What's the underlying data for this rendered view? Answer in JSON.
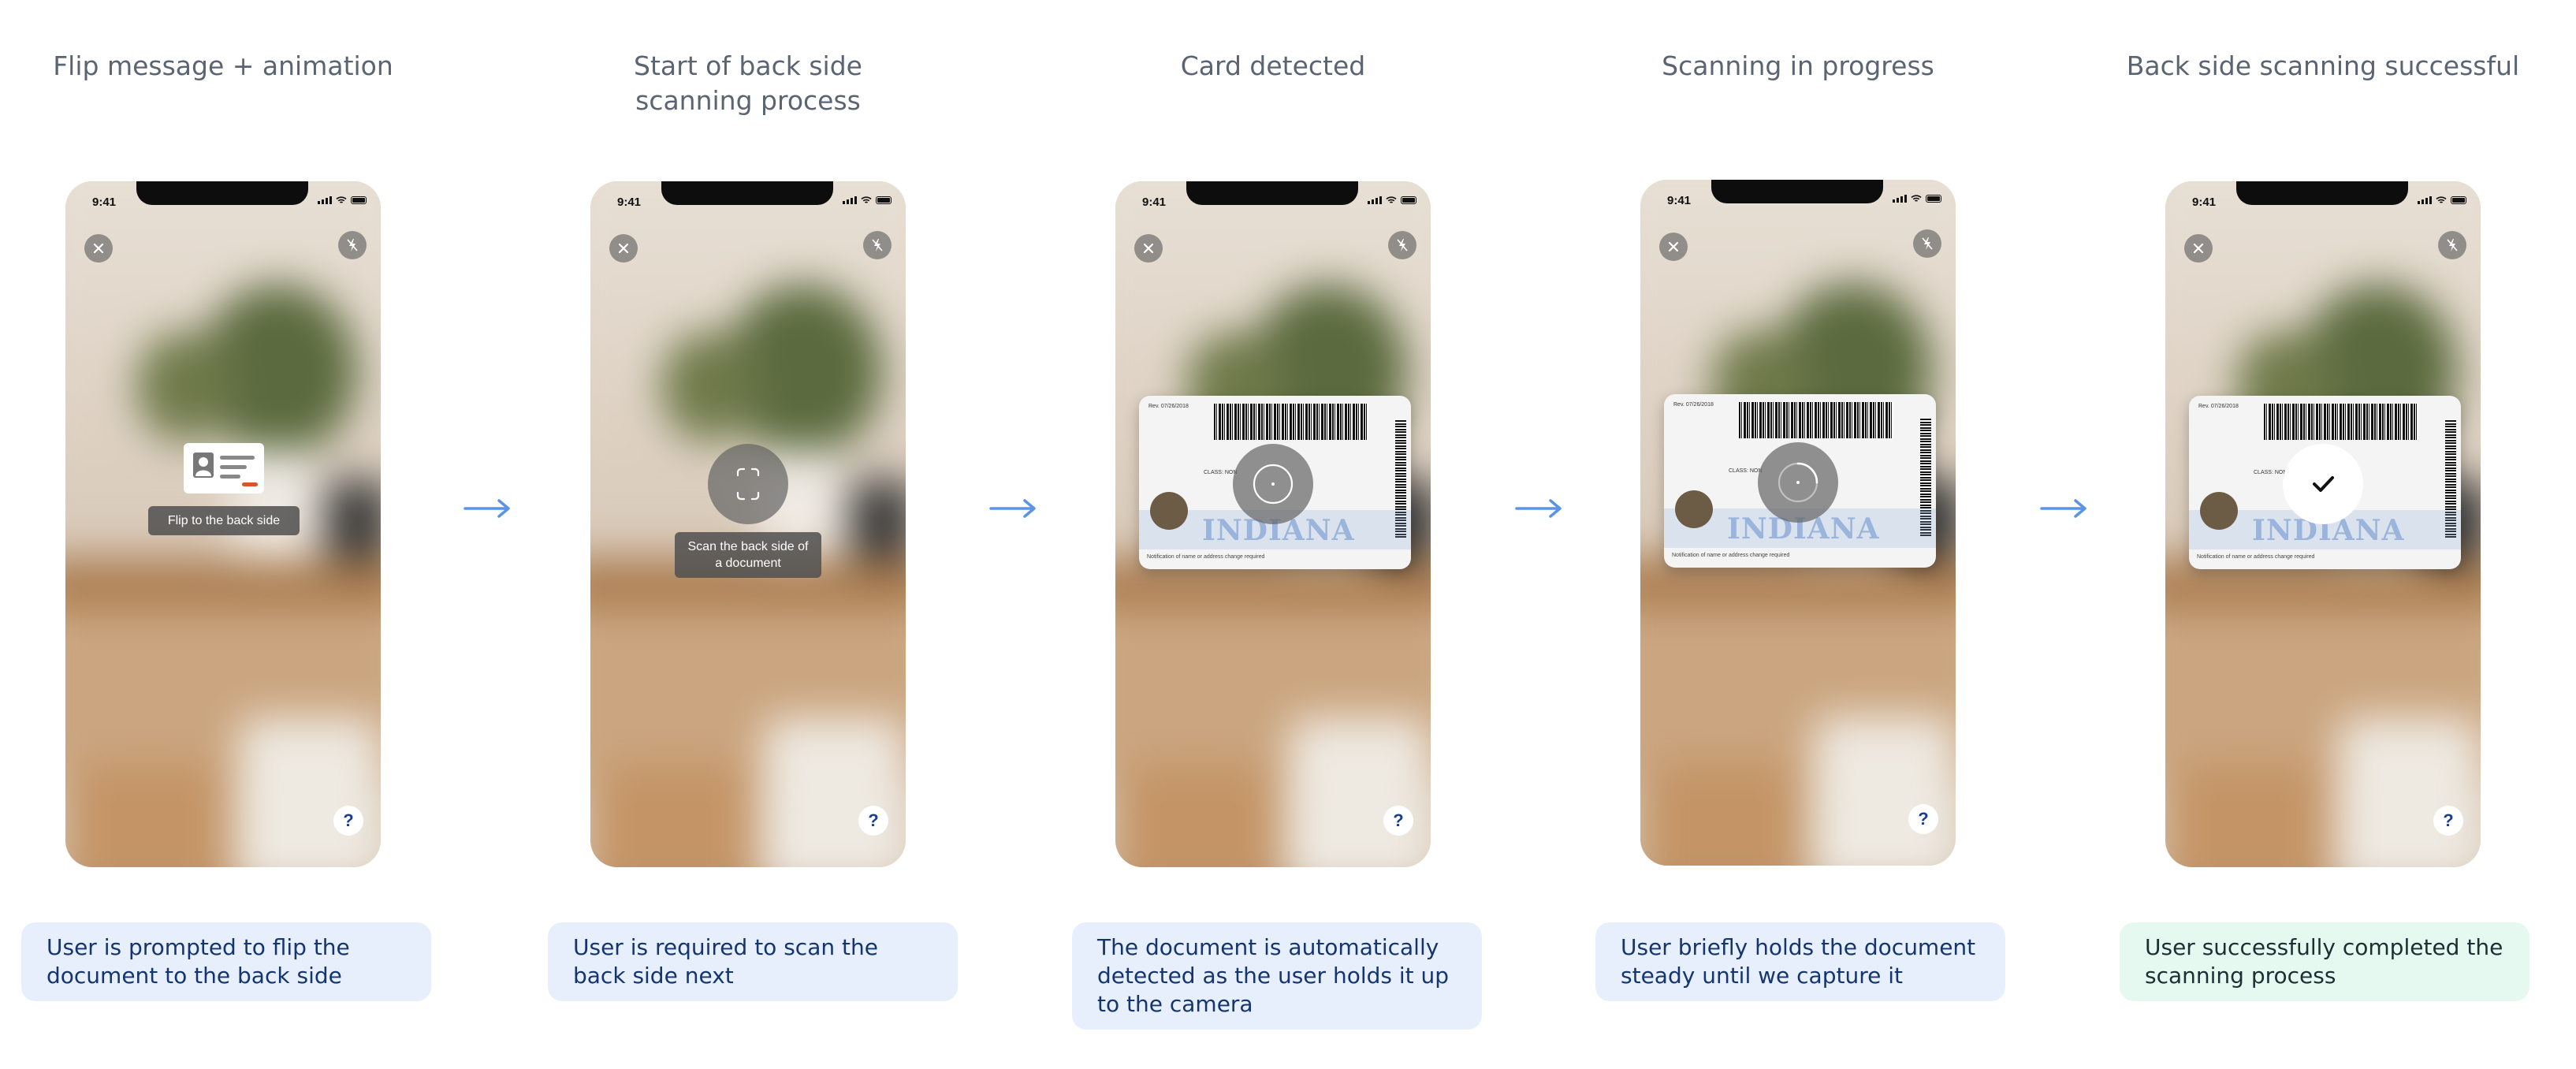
{
  "steps": [
    {
      "title": "Flip message + animation",
      "status_time": "9:41",
      "tooltip": "Flip to the back side",
      "help": "?",
      "caption": "User is prompted to flip the document to the back side"
    },
    {
      "title": "Start of back side scanning process",
      "status_time": "9:41",
      "tooltip": "Scan the back side of a document",
      "help": "?",
      "caption": "User is required to scan the back side next"
    },
    {
      "title": "Card detected",
      "status_time": "9:41",
      "help": "?",
      "card": {
        "state": "INDIANA",
        "exp": "Rev. 07/26/2018",
        "class": "CLASS: NON",
        "notice": "Notification of name or address change required"
      },
      "caption": "The document is automatically detected as the user holds it up to the camera"
    },
    {
      "title": "Scanning in progress",
      "status_time": "9:41",
      "help": "?",
      "card": {
        "state": "INDIANA",
        "exp": "Rev. 07/26/2018",
        "class": "CLASS: NON",
        "notice": "Notification of name or address change required"
      },
      "caption": "User briefly holds the document steady until we capture it"
    },
    {
      "title": "Back side scanning successful",
      "status_time": "9:41",
      "help": "?",
      "card": {
        "state": "INDIANA",
        "exp": "Rev. 07/26/2018",
        "class": "CLASS: NON",
        "notice": "Notification of name or address change required"
      },
      "caption": "User successfully completed the scanning process"
    }
  ],
  "colors": {
    "arrow": "#5b93e6",
    "caption_bg": "#e7effd",
    "caption_success_bg": "#e6f9f0",
    "title_text": "#5b6572"
  },
  "icons": [
    "close-icon",
    "flash-off-icon",
    "help-icon",
    "id-card-icon",
    "scan-frame-icon",
    "arrow-right-icon",
    "checkmark-icon"
  ]
}
